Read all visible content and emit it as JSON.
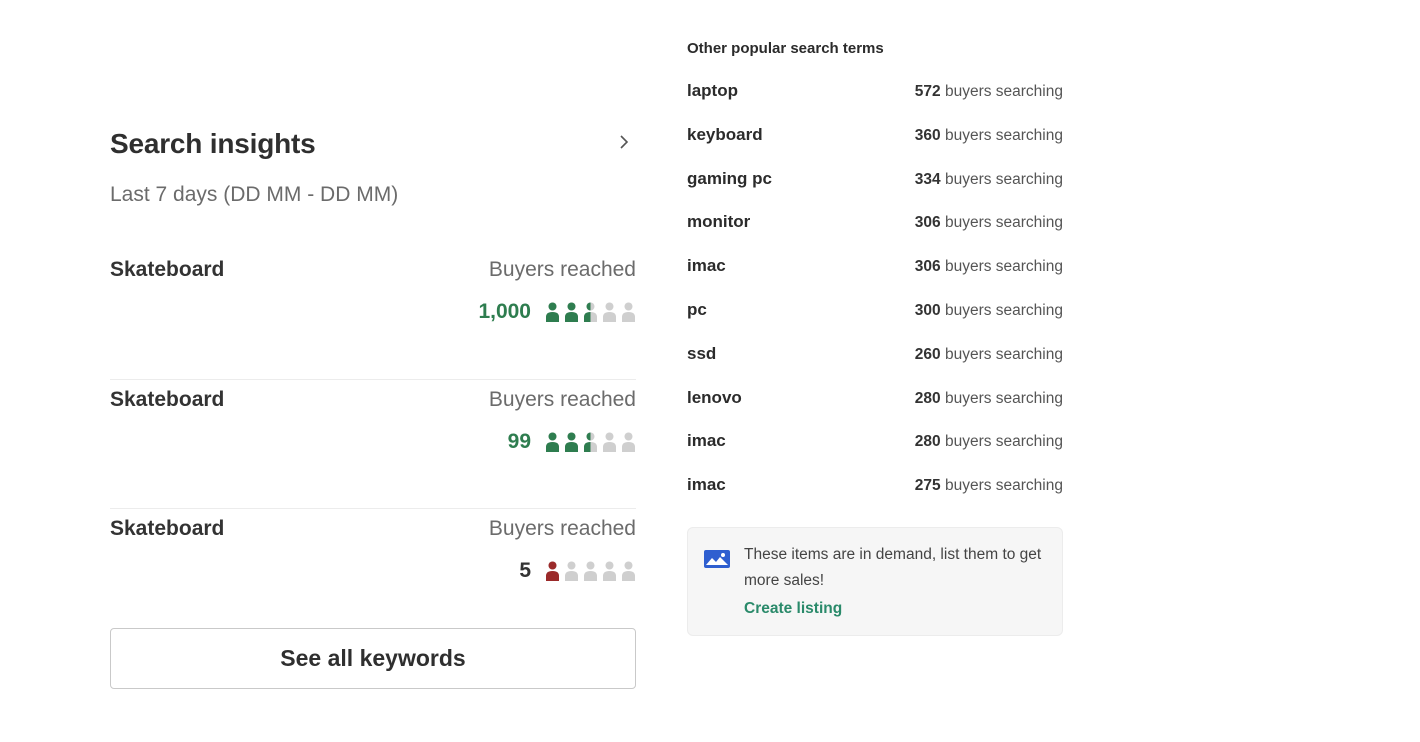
{
  "insights": {
    "title": "Search insights",
    "subtitle": "Last 7 days (DD MM - DD MM)",
    "keywords": [
      {
        "name": "Skateboard",
        "label": "Buyers reached",
        "count": "1,000",
        "level": 2.5,
        "tone": "good"
      },
      {
        "name": "Skateboard",
        "label": "Buyers reached",
        "count": "99",
        "level": 2.5,
        "tone": "good"
      },
      {
        "name": "Skateboard",
        "label": "Buyers reached",
        "count": "5",
        "level": 1,
        "tone": "low"
      }
    ],
    "see_all_label": "See all keywords"
  },
  "popular": {
    "title": "Other popular search terms",
    "suffix": "buyers searching",
    "terms": [
      {
        "term": "laptop",
        "count": "572"
      },
      {
        "term": "keyboard",
        "count": "360"
      },
      {
        "term": "gaming pc",
        "count": "334"
      },
      {
        "term": "monitor",
        "count": "306"
      },
      {
        "term": "imac",
        "count": "306"
      },
      {
        "term": "pc",
        "count": "300"
      },
      {
        "term": "ssd",
        "count": "260"
      },
      {
        "term": "lenovo",
        "count": "280"
      },
      {
        "term": "imac",
        "count": "280"
      },
      {
        "term": "imac",
        "count": "275"
      }
    ]
  },
  "demand": {
    "message": "These items are in demand, list them to get more sales!",
    "link_label": "Create listing"
  },
  "colors": {
    "green": "#2e7d4f",
    "red": "#9b2a2a",
    "grey": "#cfcfcf",
    "link": "#2a8a6a"
  }
}
